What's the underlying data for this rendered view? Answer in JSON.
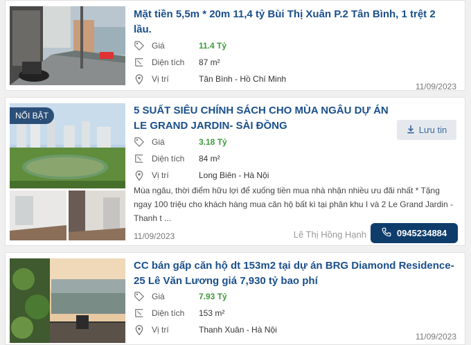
{
  "listings": [
    {
      "title": "Mặt tiền 5,5m * 20m 11,4 tỷ Bùi Thị Xuân P.2 Tân Bình, 1 trệt 2 lầu.",
      "price_label": "Giá",
      "price": "11.4 Tỷ",
      "area_label": "Diện tích",
      "area": "87 m²",
      "location_label": "Vị trí",
      "location": "Tân Bình - Hồ Chí Minh",
      "date": "11/09/2023"
    },
    {
      "badge": "NỔI BẬT",
      "title": "5 SUẤT SIÊU CHÍNH SÁCH CHO MÙA NGÂU DỰ ÁN LE GRAND JARDIN- SÀI ĐỒNG",
      "save_label": "Lưu tin",
      "price_label": "Giá",
      "price": "3.18 Tỷ",
      "area_label": "Diện tích",
      "area": "84 m²",
      "location_label": "Vị trí",
      "location": "Long Biên - Hà Nội",
      "description": "Mùa ngâu, thời điểm hữu lợi để xuống tiền mua nhà nhận nhiều ưu đãi nhất * Tặng ngay 100 triệu cho khách hàng mua căn hộ bất kì tại phân khu I và 2 Le Grand Jardin - Thanh t ...",
      "date": "11/09/2023",
      "agent": "Lê Thị Hồng Hạnh",
      "phone": "0945234884"
    },
    {
      "title": "CC bán gấp căn hộ dt 153m2 tại dự án BRG Diamond Residence- 25 Lê Văn Lương giá 7,930 tỷ bao phí",
      "price_label": "Giá",
      "price": "7.93 Tỷ",
      "area_label": "Diện tích",
      "area": "153 m²",
      "location_label": "Vị trí",
      "location": "Thanh Xuân - Hà Nội",
      "date": "11/09/2023"
    }
  ],
  "icons": {
    "price": "tag-icon",
    "area": "area-icon",
    "location": "map-pin-icon",
    "save": "download-icon",
    "phone": "phone-icon"
  },
  "colors": {
    "title": "#1a4f8b",
    "price": "#3c9a3c",
    "badge": "#2a4f78",
    "phone_button": "#0e3d6b"
  }
}
